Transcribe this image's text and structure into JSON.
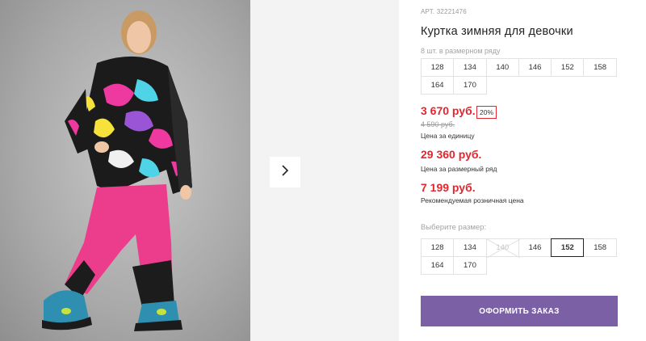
{
  "gallery": {
    "photo_alt": "girl-in-winter-suit-photo",
    "next_icon": "chevron-right-icon"
  },
  "product": {
    "article": "АРТ. 32221476",
    "title": "Куртка зимняя для девочки",
    "quantity_hint": "8 шт. в размерном ряду",
    "size_row_grid": [
      [
        "128",
        "134",
        "140",
        "146",
        "152",
        "158"
      ],
      [
        "164",
        "170"
      ]
    ],
    "price": "3 670 руб.",
    "discount_badge": "20%",
    "old_price": "4 590 руб.",
    "price_caption": "Цена за единицу",
    "row_price": "29 360 руб.",
    "row_price_caption": "Цена за размерный ряд",
    "rrp_price": "7 199 руб.",
    "rrp_caption": "Рекомендуемая розничная цена",
    "choose_size_label": "Выберите размер:",
    "size_options": [
      [
        "128",
        "134",
        "140",
        "146",
        "152",
        "158"
      ],
      [
        "164",
        "170"
      ]
    ],
    "selected_size": "152",
    "disabled_sizes": [
      "140"
    ],
    "order_button": "ОФОРМИТЬ ЗАКАЗ"
  },
  "colors": {
    "price_red": "#e3262f",
    "order_button_bg": "#7b60a6",
    "pants_pink": "#ec3d8c"
  }
}
